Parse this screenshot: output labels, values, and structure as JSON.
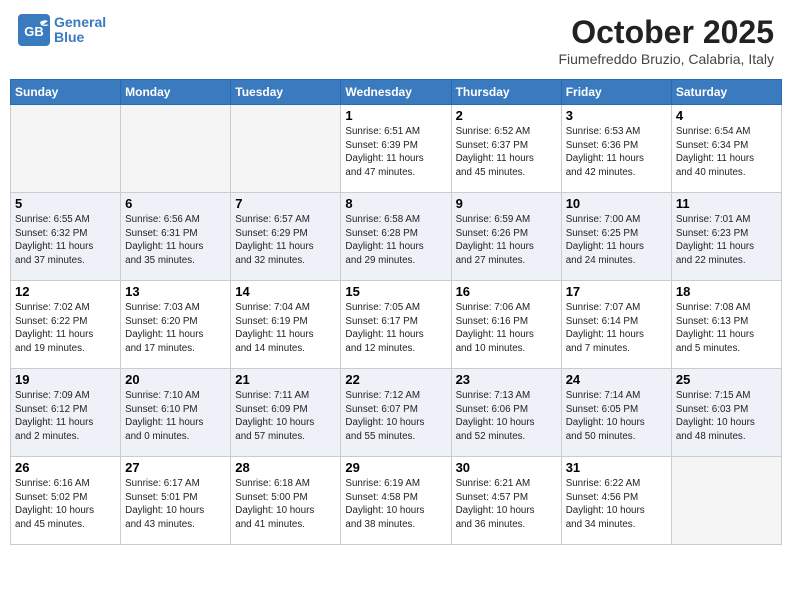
{
  "header": {
    "logo_line1": "General",
    "logo_line2": "Blue",
    "month_title": "October 2025",
    "subtitle": "Fiumefreddo Bruzio, Calabria, Italy"
  },
  "days_of_week": [
    "Sunday",
    "Monday",
    "Tuesday",
    "Wednesday",
    "Thursday",
    "Friday",
    "Saturday"
  ],
  "weeks": [
    [
      {
        "day": "",
        "info": ""
      },
      {
        "day": "",
        "info": ""
      },
      {
        "day": "",
        "info": ""
      },
      {
        "day": "1",
        "info": "Sunrise: 6:51 AM\nSunset: 6:39 PM\nDaylight: 11 hours\nand 47 minutes."
      },
      {
        "day": "2",
        "info": "Sunrise: 6:52 AM\nSunset: 6:37 PM\nDaylight: 11 hours\nand 45 minutes."
      },
      {
        "day": "3",
        "info": "Sunrise: 6:53 AM\nSunset: 6:36 PM\nDaylight: 11 hours\nand 42 minutes."
      },
      {
        "day": "4",
        "info": "Sunrise: 6:54 AM\nSunset: 6:34 PM\nDaylight: 11 hours\nand 40 minutes."
      }
    ],
    [
      {
        "day": "5",
        "info": "Sunrise: 6:55 AM\nSunset: 6:32 PM\nDaylight: 11 hours\nand 37 minutes."
      },
      {
        "day": "6",
        "info": "Sunrise: 6:56 AM\nSunset: 6:31 PM\nDaylight: 11 hours\nand 35 minutes."
      },
      {
        "day": "7",
        "info": "Sunrise: 6:57 AM\nSunset: 6:29 PM\nDaylight: 11 hours\nand 32 minutes."
      },
      {
        "day": "8",
        "info": "Sunrise: 6:58 AM\nSunset: 6:28 PM\nDaylight: 11 hours\nand 29 minutes."
      },
      {
        "day": "9",
        "info": "Sunrise: 6:59 AM\nSunset: 6:26 PM\nDaylight: 11 hours\nand 27 minutes."
      },
      {
        "day": "10",
        "info": "Sunrise: 7:00 AM\nSunset: 6:25 PM\nDaylight: 11 hours\nand 24 minutes."
      },
      {
        "day": "11",
        "info": "Sunrise: 7:01 AM\nSunset: 6:23 PM\nDaylight: 11 hours\nand 22 minutes."
      }
    ],
    [
      {
        "day": "12",
        "info": "Sunrise: 7:02 AM\nSunset: 6:22 PM\nDaylight: 11 hours\nand 19 minutes."
      },
      {
        "day": "13",
        "info": "Sunrise: 7:03 AM\nSunset: 6:20 PM\nDaylight: 11 hours\nand 17 minutes."
      },
      {
        "day": "14",
        "info": "Sunrise: 7:04 AM\nSunset: 6:19 PM\nDaylight: 11 hours\nand 14 minutes."
      },
      {
        "day": "15",
        "info": "Sunrise: 7:05 AM\nSunset: 6:17 PM\nDaylight: 11 hours\nand 12 minutes."
      },
      {
        "day": "16",
        "info": "Sunrise: 7:06 AM\nSunset: 6:16 PM\nDaylight: 11 hours\nand 10 minutes."
      },
      {
        "day": "17",
        "info": "Sunrise: 7:07 AM\nSunset: 6:14 PM\nDaylight: 11 hours\nand 7 minutes."
      },
      {
        "day": "18",
        "info": "Sunrise: 7:08 AM\nSunset: 6:13 PM\nDaylight: 11 hours\nand 5 minutes."
      }
    ],
    [
      {
        "day": "19",
        "info": "Sunrise: 7:09 AM\nSunset: 6:12 PM\nDaylight: 11 hours\nand 2 minutes."
      },
      {
        "day": "20",
        "info": "Sunrise: 7:10 AM\nSunset: 6:10 PM\nDaylight: 11 hours\nand 0 minutes."
      },
      {
        "day": "21",
        "info": "Sunrise: 7:11 AM\nSunset: 6:09 PM\nDaylight: 10 hours\nand 57 minutes."
      },
      {
        "day": "22",
        "info": "Sunrise: 7:12 AM\nSunset: 6:07 PM\nDaylight: 10 hours\nand 55 minutes."
      },
      {
        "day": "23",
        "info": "Sunrise: 7:13 AM\nSunset: 6:06 PM\nDaylight: 10 hours\nand 52 minutes."
      },
      {
        "day": "24",
        "info": "Sunrise: 7:14 AM\nSunset: 6:05 PM\nDaylight: 10 hours\nand 50 minutes."
      },
      {
        "day": "25",
        "info": "Sunrise: 7:15 AM\nSunset: 6:03 PM\nDaylight: 10 hours\nand 48 minutes."
      }
    ],
    [
      {
        "day": "26",
        "info": "Sunrise: 6:16 AM\nSunset: 5:02 PM\nDaylight: 10 hours\nand 45 minutes."
      },
      {
        "day": "27",
        "info": "Sunrise: 6:17 AM\nSunset: 5:01 PM\nDaylight: 10 hours\nand 43 minutes."
      },
      {
        "day": "28",
        "info": "Sunrise: 6:18 AM\nSunset: 5:00 PM\nDaylight: 10 hours\nand 41 minutes."
      },
      {
        "day": "29",
        "info": "Sunrise: 6:19 AM\nSunset: 4:58 PM\nDaylight: 10 hours\nand 38 minutes."
      },
      {
        "day": "30",
        "info": "Sunrise: 6:21 AM\nSunset: 4:57 PM\nDaylight: 10 hours\nand 36 minutes."
      },
      {
        "day": "31",
        "info": "Sunrise: 6:22 AM\nSunset: 4:56 PM\nDaylight: 10 hours\nand 34 minutes."
      },
      {
        "day": "",
        "info": ""
      }
    ]
  ]
}
